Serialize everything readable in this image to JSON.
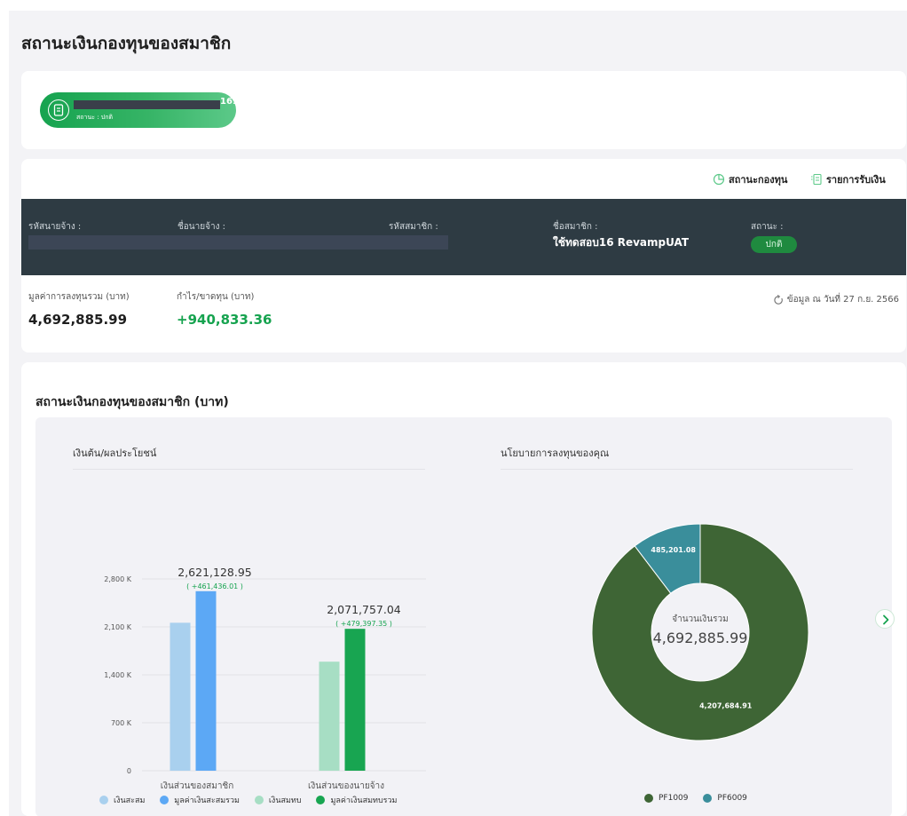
{
  "page": {
    "title": "สถานะเงินกองทุนของสมาชิก"
  },
  "fund": {
    "code_suffix": "169)",
    "status": "สถานะ : ปกติ",
    "icon": "document-icon"
  },
  "tabs": [
    {
      "label": "สถานะกองทุน",
      "icon": "pie-chart-icon",
      "active": true
    },
    {
      "label": "รายการรับเงิน",
      "icon": "list-icon",
      "active": false
    }
  ],
  "member": {
    "employer_code_label": "รหัสนายจ้าง :",
    "employer_name_label": "ชื่อนายจ้าง :",
    "member_code_label": "รหัสสมาชิก :",
    "member_name_label": "ชื่อสมาชิก :",
    "member_name": "ใช้ทดสอบ16 RevampUAT",
    "status_label": "สถานะ :",
    "status_value": "ปกติ"
  },
  "summary": {
    "total_label": "มูลค่าการลงทุนรวม (บาท)",
    "total_value": "4,692,885.99",
    "profit_label": "กำไร/ขาดทุน (บาท)",
    "profit_value": "+940,833.36",
    "as_of": "ข้อมูล ณ วันที่ 27 ก.ย. 2566"
  },
  "section": {
    "title": "สถานะเงินกองทุนของสมาชิก (บาท)",
    "bar_heading": "เงินต้น/ผลประโยชน์",
    "donut_heading": "นโยบายการลงทุนของคุณ"
  },
  "colors": {
    "accent": "#16a34f",
    "member_band": "#2e3b43",
    "bar_savings": "#a9d0ee",
    "bar_savings_total": "#5ca8f5",
    "bar_contrib": "#a7dec4",
    "bar_contrib_total": "#18a551",
    "pf1009": "#3e6535",
    "pf6009": "#3a8e9b"
  },
  "chart_data": [
    {
      "type": "bar",
      "title": "เงินต้น/ผลประโยชน์",
      "categories": [
        "เงินส่วนของสมาชิก",
        "เงินส่วนของนายจ้าง"
      ],
      "series": [
        {
          "name": "เงินสะสม",
          "values": [
            2160000,
            1654000
          ]
        },
        {
          "name": "มูลค่าเงินสะสมรวม",
          "values": [
            2621128.95,
            2071757.04
          ]
        },
        {
          "name": "เงินสมทบ",
          "values": [
            null,
            1592000
          ]
        },
        {
          "name": "มูลค่าเงินสมทบรวม",
          "values": [
            null,
            2071757.04
          ]
        }
      ],
      "ylim": [
        0,
        2800000
      ],
      "yticks": [
        "0",
        "700 K",
        "1,400 K",
        "2,100 K",
        "2,800 K"
      ],
      "ytick_values": [
        0,
        700000,
        1400000,
        2100000,
        2800000
      ],
      "annotations": [
        {
          "total": "2,621,128.95",
          "change": "( +461,436.01 )"
        },
        {
          "total": "2,071,757.04",
          "change": "( +479,397.35 )"
        }
      ],
      "legend_position": "bottom",
      "grid": true
    },
    {
      "type": "pie",
      "title": "นโยบายการลงทุนของคุณ",
      "center_label": "จำนวนเงินรวม",
      "center_value": "4,692,885.99",
      "slices": [
        {
          "name": "PF1009",
          "value": 4207684.91,
          "label": "4,207,684.91"
        },
        {
          "name": "PF6009",
          "value": 485201.08,
          "label": "485,201.08"
        }
      ],
      "legend_position": "bottom"
    }
  ]
}
